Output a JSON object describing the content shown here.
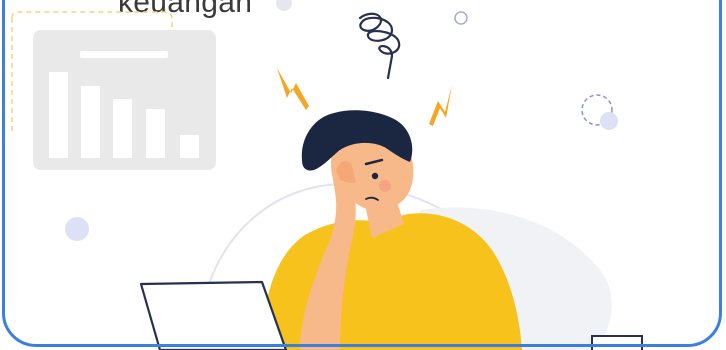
{
  "caption": {
    "text": "keuangan"
  },
  "illustration": {
    "subject": "stressed-person-at-laptop",
    "icons": [
      "bar-chart-icon",
      "scribble-icon",
      "lightning-icon",
      "dashed-circle-icon"
    ]
  },
  "colors": {
    "frame": "#3d7fe0",
    "shirt": "#f6c21b",
    "hair": "#1b2640",
    "skin": "#f8b98a",
    "lightning": "#f5a623",
    "chart": "#e9e9e9",
    "accent_circle": "#d9def6"
  }
}
